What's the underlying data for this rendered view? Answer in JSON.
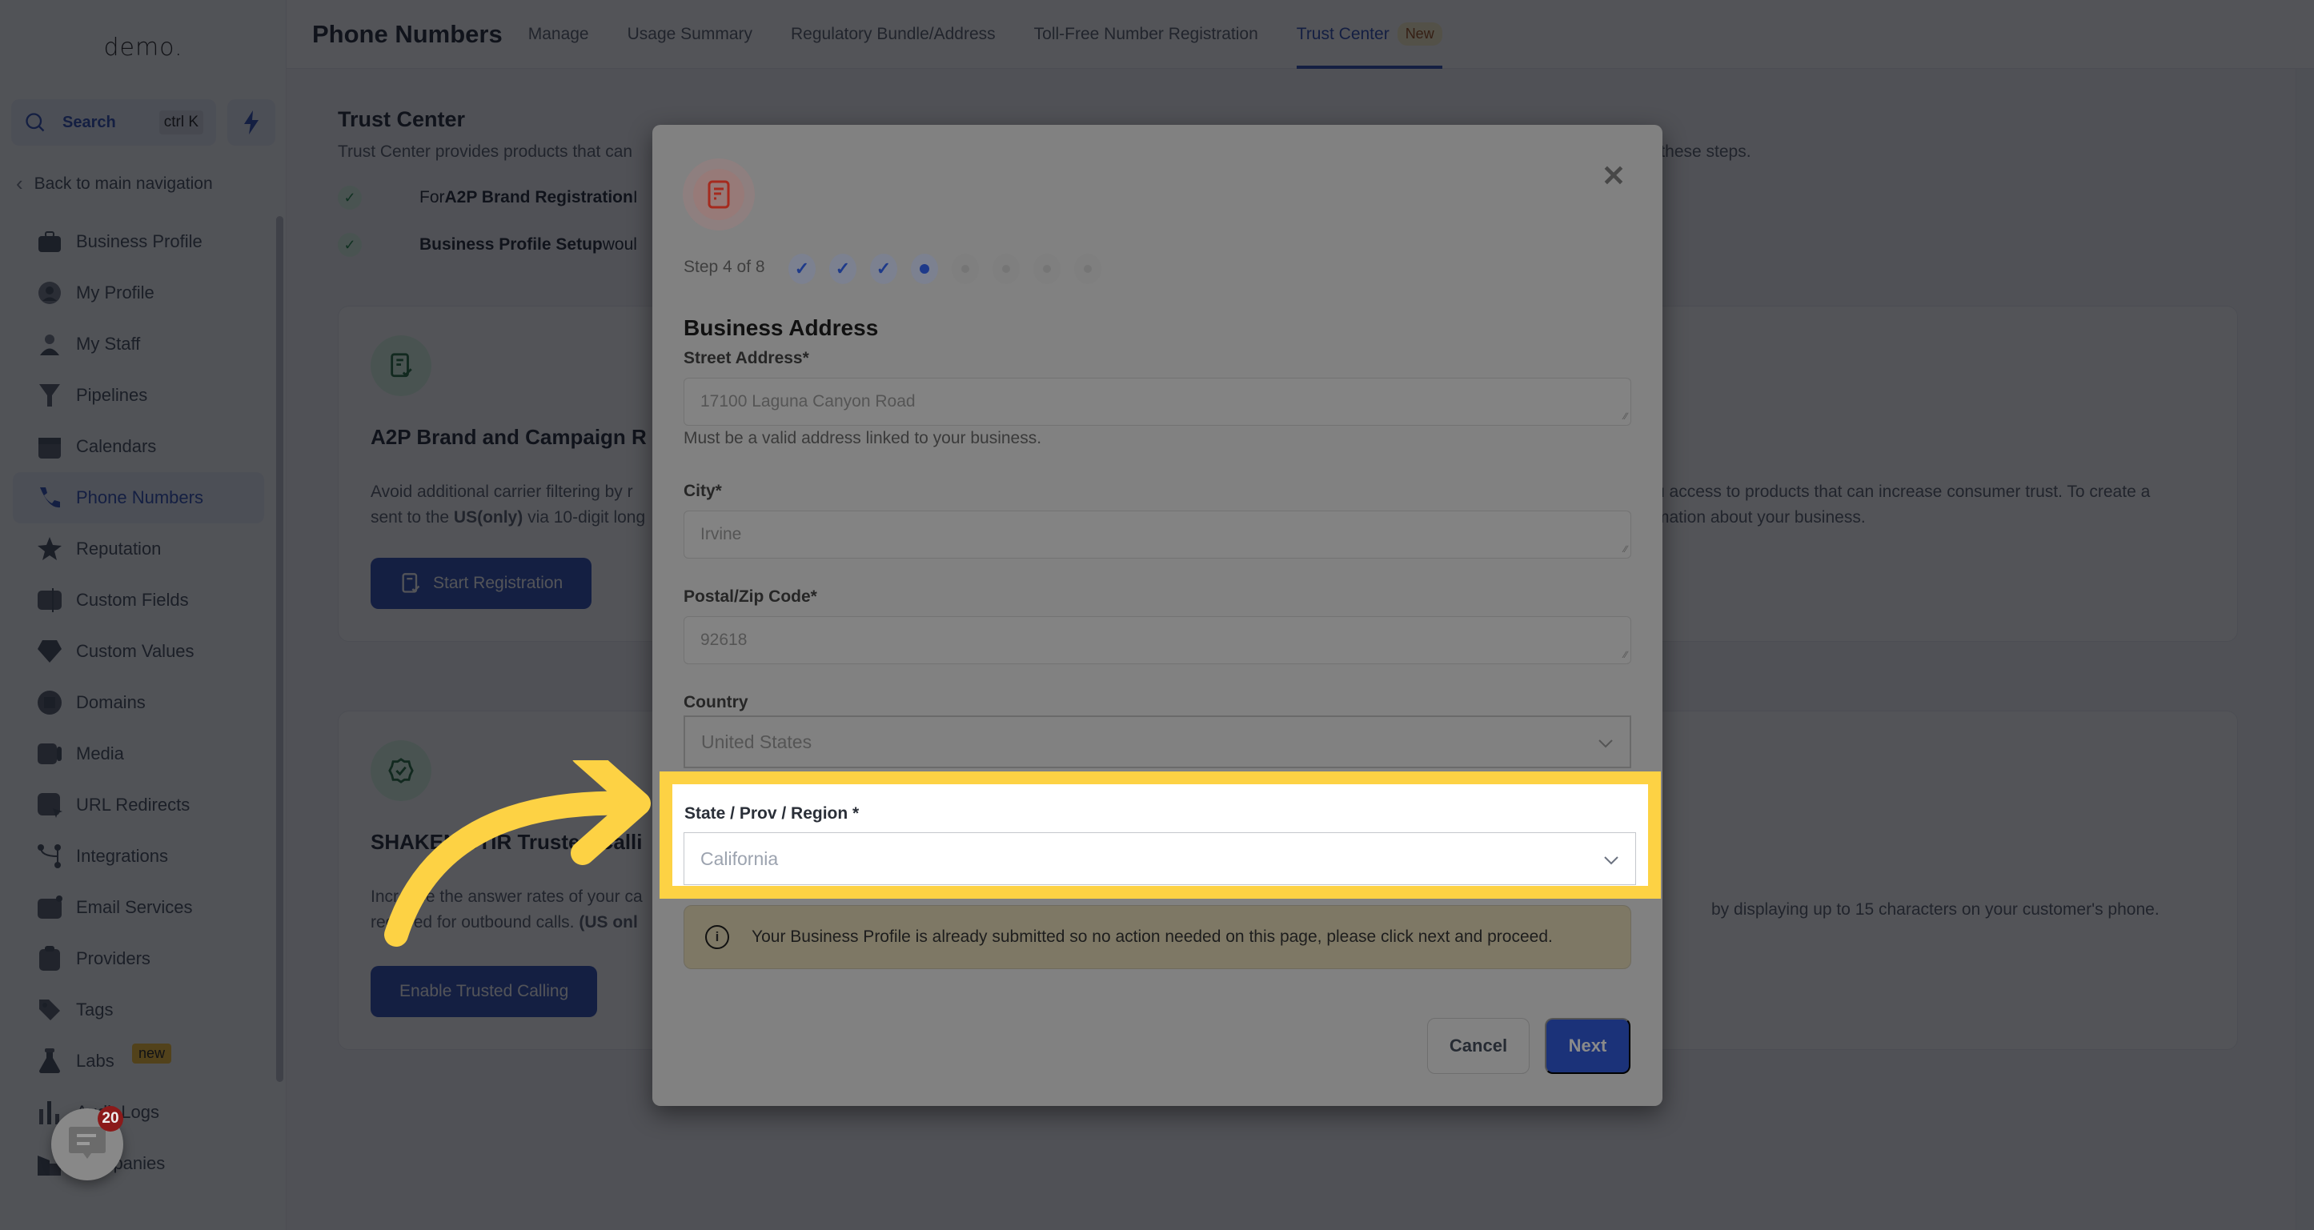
{
  "sidebar": {
    "logo": "demo.",
    "search_label": "Search",
    "search_shortcut": "ctrl K",
    "back_label": "Back to main navigation",
    "items": [
      {
        "label": "Business Profile",
        "icon": "briefcase-icon"
      },
      {
        "label": "My Profile",
        "icon": "user-circle-icon"
      },
      {
        "label": "My Staff",
        "icon": "user-icon"
      },
      {
        "label": "Pipelines",
        "icon": "funnel-icon"
      },
      {
        "label": "Calendars",
        "icon": "calendar-icon"
      },
      {
        "label": "Phone Numbers",
        "icon": "phone-icon",
        "active": true
      },
      {
        "label": "Reputation",
        "icon": "star-icon"
      },
      {
        "label": "Custom Fields",
        "icon": "text-field-icon"
      },
      {
        "label": "Custom Values",
        "icon": "gem-icon"
      },
      {
        "label": "Domains",
        "icon": "globe-icon"
      },
      {
        "label": "Media",
        "icon": "video-icon"
      },
      {
        "label": "URL Redirects",
        "icon": "cursor-icon"
      },
      {
        "label": "Integrations",
        "icon": "git-branch-icon"
      },
      {
        "label": "Email Services",
        "icon": "mail-icon"
      },
      {
        "label": "Providers",
        "icon": "clipboard-check-icon"
      },
      {
        "label": "Tags",
        "icon": "tag-icon"
      },
      {
        "label": "Labs",
        "icon": "flask-icon",
        "badge": "new"
      },
      {
        "label": "Audit Logs",
        "icon": "bar-chart-icon"
      },
      {
        "label": "Companies",
        "icon": "building-icon"
      }
    ]
  },
  "header": {
    "title": "Phone Numbers",
    "tabs": [
      {
        "label": "Manage"
      },
      {
        "label": "Usage Summary"
      },
      {
        "label": "Regulatory Bundle/Address"
      },
      {
        "label": "Toll-Free Number Registration"
      },
      {
        "label": "Trust Center",
        "active": true,
        "badge": "New"
      }
    ]
  },
  "trust_center": {
    "title": "Trust Center",
    "description_visible": "Trust Center provides products that can",
    "description_tail": "v these steps.",
    "checks": [
      {
        "prefix": "For ",
        "bold": "A2P Brand Registration",
        "rest": " I"
      },
      {
        "prefix": "",
        "bold": "Business Profile Setup",
        "rest": " woul"
      }
    ],
    "cards": [
      {
        "title": "A2P Brand and Campaign R",
        "desc_line1": "Avoid additional carrier filtering by r",
        "desc_line2_pre": "sent to the ",
        "desc_line2_bold": "US(only)",
        "desc_line2_post": " via 10-digit long",
        "desc_right_line1": "u access to products that can increase consumer trust. To create a",
        "desc_right_line2": "mation about your business.",
        "button": "Start Registration"
      },
      {
        "title": "SHAKEN/STIR Trusted Calli",
        "desc_line1": "Increase the answer rates of your ca",
        "desc_line2_pre": "required for outbound calls. ",
        "desc_line2_bold": "(US onl",
        "desc_right_line1": "by displaying up to 15 characters on your customer's phone.",
        "button": "Enable Trusted Calling"
      }
    ]
  },
  "modal": {
    "step_text": "Step 4 of 8",
    "steps_total": 8,
    "steps_completed": 3,
    "current_step": 4,
    "section_title": "Business Address",
    "fields": {
      "street": {
        "label": "Street Address*",
        "value": "17100 Laguna Canyon Road",
        "help": "Must be a valid address linked to your business."
      },
      "city": {
        "label": "City*",
        "value": "Irvine"
      },
      "postal": {
        "label": "Postal/Zip Code*",
        "value": "92618"
      },
      "country": {
        "label": "Country",
        "value": "United States"
      },
      "state": {
        "label": "State / Prov / Region *",
        "value": "California"
      }
    },
    "info_message": "Your Business Profile is already submitted so no action needed on this page, please click next and proceed.",
    "cancel_label": "Cancel",
    "next_label": "Next"
  },
  "chat_widget": {
    "badge_count": "20"
  },
  "colors": {
    "brand_blue": "#1e40af",
    "highlight_yellow": "#fdd244",
    "overlay": "#111218"
  }
}
